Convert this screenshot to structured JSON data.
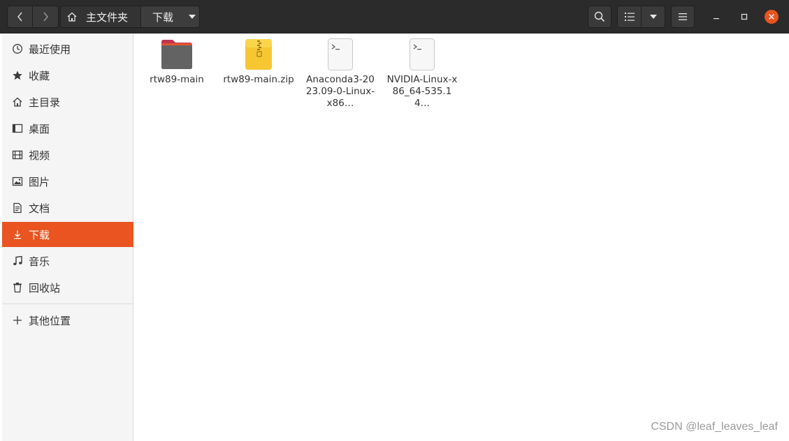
{
  "breadcrumb": {
    "home_label": "主文件夹",
    "current_label": "下载"
  },
  "sidebar": {
    "items": [
      {
        "label": "最近使用",
        "icon": "clock-icon"
      },
      {
        "label": "收藏",
        "icon": "star-icon"
      },
      {
        "label": "主目录",
        "icon": "home-icon"
      },
      {
        "label": "桌面",
        "icon": "desktop-icon"
      },
      {
        "label": "视频",
        "icon": "video-icon"
      },
      {
        "label": "图片",
        "icon": "picture-icon"
      },
      {
        "label": "文档",
        "icon": "document-icon"
      },
      {
        "label": "下载",
        "icon": "download-icon",
        "active": true
      },
      {
        "label": "音乐",
        "icon": "music-icon"
      },
      {
        "label": "回收站",
        "icon": "trash-icon"
      }
    ],
    "other_locations": {
      "label": "其他位置",
      "icon": "plus-icon"
    }
  },
  "files": [
    {
      "label": "rtw89-main",
      "icon": "folder-icon"
    },
    {
      "label": "rtw89-main.zip",
      "icon": "zip-archive-icon"
    },
    {
      "label": "Anaconda3-2023.09-0-Linux-x86…",
      "icon": "script-file-icon"
    },
    {
      "label": "NVIDIA-Linux-x86_64-535.14…",
      "icon": "script-file-icon"
    }
  ],
  "watermark": "CSDN @leaf_leaves_leaf",
  "colors": {
    "accent": "#e95420",
    "headerbar": "#2b2b2b",
    "sidebar_bg": "#f5f5f5"
  }
}
